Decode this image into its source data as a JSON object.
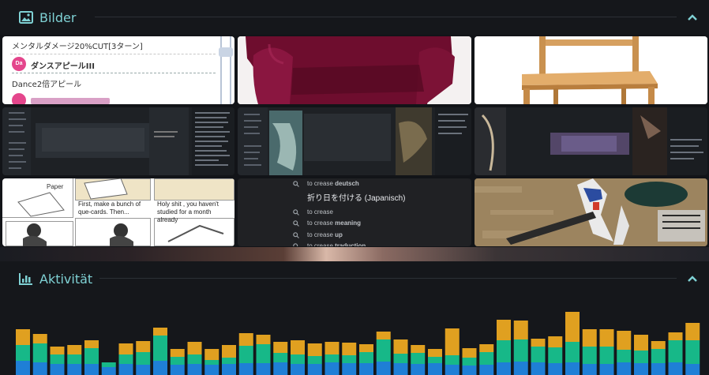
{
  "sections": {
    "images": {
      "title": "Bilder",
      "icon": "image-icon",
      "collapse_icon": "chevron-up-icon"
    },
    "activity": {
      "title": "Aktivität",
      "icon": "bar-chart-icon",
      "collapse_icon": "chevron-up-icon"
    }
  },
  "gallery": {
    "thumb1": {
      "line1": "メンタルダメージ20%CUT[3ターン]",
      "badge": "Da",
      "line2": "ダンスアピールIII",
      "line3": "Dance2倍アピール"
    },
    "thumb7": {
      "label1": "Paper",
      "text1": "First, make a bunch of que-cards. Then...",
      "text2": "Holy shit , you haven't studied for a month already"
    },
    "thumb8": {
      "items": [
        {
          "text": "to crease ",
          "bold": "deutsch"
        },
        {
          "text": "折り日を付ける (Japanisch)",
          "bold": ""
        },
        {
          "text": "to crease",
          "bold": ""
        },
        {
          "text": "to crease ",
          "bold": "meaning"
        },
        {
          "text": "to crease ",
          "bold": "up"
        },
        {
          "text": "to crease ",
          "bold": "traduction"
        }
      ]
    }
  },
  "colors": {
    "accent": "#7fd1d4",
    "bar_blue": "#1f7fd6",
    "bar_green": "#17b888",
    "bar_orange": "#e0a020"
  },
  "chart_data": {
    "type": "bar",
    "stacked": true,
    "series": [
      {
        "values": [
          18,
          16,
          14,
          14,
          14,
          10,
          14,
          13,
          18,
          13,
          14,
          13,
          14,
          15,
          15,
          16,
          14,
          14,
          16,
          15,
          15,
          17,
          15,
          14,
          15,
          13,
          12,
          13,
          16,
          17,
          16,
          15,
          16,
          14,
          14,
          16,
          15,
          15,
          16,
          14
        ]
      },
      {
        "values": [
          20,
          24,
          12,
          12,
          20,
          6,
          12,
          16,
          32,
          10,
          12,
          6,
          8,
          22,
          24,
          12,
          12,
          10,
          10,
          10,
          14,
          28,
          12,
          14,
          8,
          12,
          10,
          16,
          28,
          28,
          20,
          20,
          26,
          22,
          22,
          16,
          16,
          18,
          28,
          30
        ]
      },
      {
        "values": [
          20,
          12,
          10,
          12,
          10,
          0,
          14,
          14,
          10,
          10,
          16,
          14,
          16,
          16,
          12,
          14,
          18,
          16,
          16,
          16,
          10,
          10,
          18,
          10,
          10,
          34,
          12,
          10,
          26,
          24,
          10,
          14,
          38,
          22,
          22,
          24,
          20,
          10,
          10,
          22
        ]
      }
    ],
    "grid": false,
    "legend": "none"
  }
}
